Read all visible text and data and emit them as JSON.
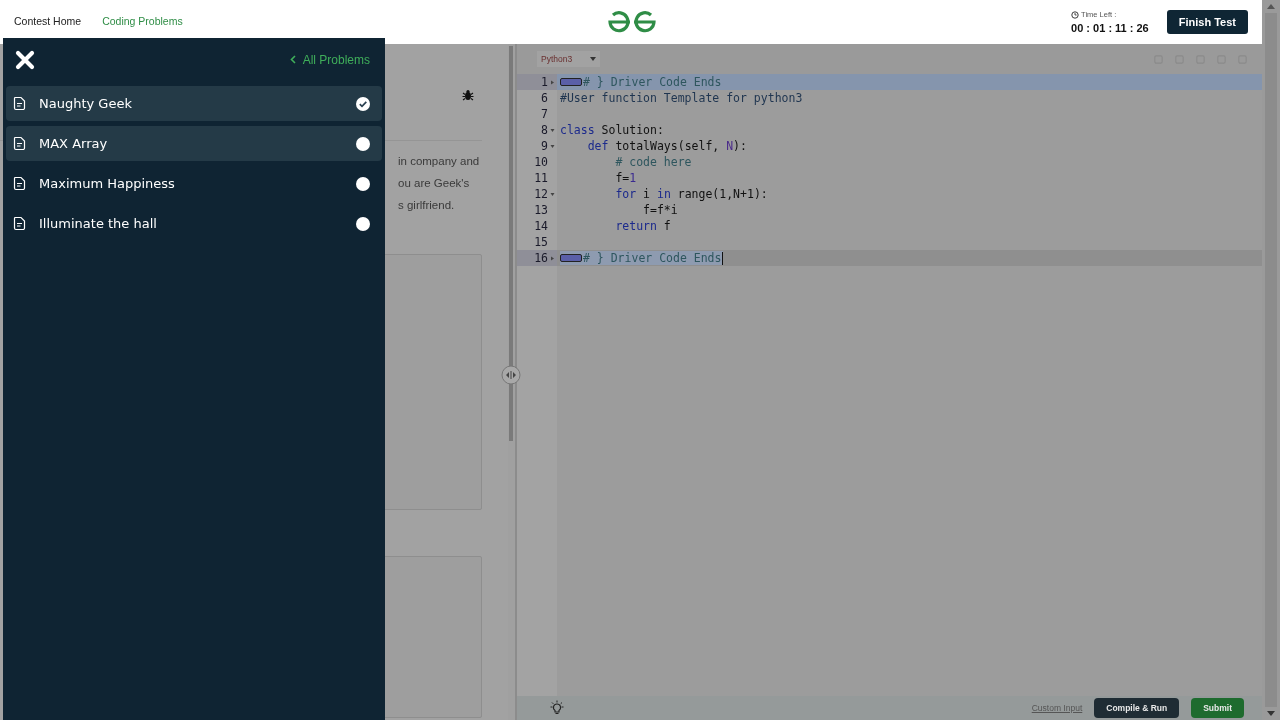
{
  "header": {
    "nav": [
      {
        "label": "Contest Home",
        "selected": false
      },
      {
        "label": "Coding Problems",
        "selected": true
      }
    ],
    "timer": {
      "label": "Time Left :",
      "value": "00 : 01 : 11 : 26"
    },
    "finish_button": "Finish Test"
  },
  "sidebar": {
    "back_link": "All Problems",
    "problems": [
      {
        "title": "Naughty Geek",
        "solved": true,
        "highlighted": true
      },
      {
        "title": "MAX Array",
        "solved": false,
        "highlighted": true
      },
      {
        "title": "Maximum Happiness",
        "solved": false,
        "highlighted": false
      },
      {
        "title": "Illuminate the hall",
        "solved": false,
        "highlighted": false
      }
    ]
  },
  "problem_pane": {
    "text_lines": [
      "in company and",
      "ou are Geek's",
      "s girlfriend."
    ]
  },
  "editor": {
    "language": "Python3",
    "lines": [
      {
        "number": "1",
        "foldable": true,
        "folded": true,
        "selected": true,
        "cursor": false,
        "tokens": [
          {
            "kind": "comment",
            "text": "# } Driver Code Ends"
          }
        ]
      },
      {
        "number": "6",
        "foldable": false,
        "folded": false,
        "selected": false,
        "cursor": false,
        "tokens": [
          {
            "kind": "comment-dark",
            "text": "#User function Template for python3"
          }
        ]
      },
      {
        "number": "7",
        "foldable": false,
        "folded": false,
        "selected": false,
        "cursor": false
      },
      {
        "number": "8",
        "foldable": true,
        "folded": false,
        "selected": false,
        "cursor": false,
        "tokens": [
          {
            "kind": "keyword",
            "text": "class"
          },
          {
            "kind": "plain",
            "text": " Solution:"
          }
        ]
      },
      {
        "number": "9",
        "foldable": true,
        "folded": false,
        "selected": false,
        "cursor": false,
        "tokens": [
          {
            "kind": "keyword",
            "text": "    def"
          },
          {
            "kind": "plain",
            "text": " totalWays(self, "
          },
          {
            "kind": "variable",
            "text": "N"
          },
          {
            "kind": "plain",
            "text": "):"
          }
        ]
      },
      {
        "number": "10",
        "foldable": false,
        "folded": false,
        "selected": false,
        "cursor": false,
        "tokens": [
          {
            "kind": "comment",
            "text": "        # code here"
          }
        ]
      },
      {
        "number": "11",
        "foldable": false,
        "folded": false,
        "selected": false,
        "cursor": false,
        "tokens": [
          {
            "kind": "plain",
            "text": "        f="
          },
          {
            "kind": "number",
            "text": "1"
          }
        ]
      },
      {
        "number": "12",
        "foldable": true,
        "folded": false,
        "selected": false,
        "cursor": false,
        "tokens": [
          {
            "kind": "keyword",
            "text": "        for"
          },
          {
            "kind": "plain",
            "text": " i "
          },
          {
            "kind": "keyword",
            "text": "in"
          },
          {
            "kind": "plain",
            "text": " range(1,N+1):"
          }
        ]
      },
      {
        "number": "13",
        "foldable": false,
        "folded": false,
        "selected": false,
        "cursor": false,
        "tokens": [
          {
            "kind": "plain",
            "text": "            f=f*i"
          }
        ]
      },
      {
        "number": "14",
        "foldable": false,
        "folded": false,
        "selected": false,
        "cursor": false,
        "tokens": [
          {
            "kind": "keyword",
            "text": "        return"
          },
          {
            "kind": "plain",
            "text": " f"
          }
        ]
      },
      {
        "number": "15",
        "foldable": false,
        "folded": false,
        "selected": false,
        "cursor": false
      },
      {
        "number": "16",
        "foldable": true,
        "folded": true,
        "selected": true,
        "cursor": true,
        "tokens": [
          {
            "kind": "comment",
            "text": "# } Driver Code Ends"
          }
        ]
      }
    ]
  },
  "footer": {
    "custom_input": "Custom Input",
    "compile_button": "Compile & Run",
    "submit_button": "Submit"
  }
}
